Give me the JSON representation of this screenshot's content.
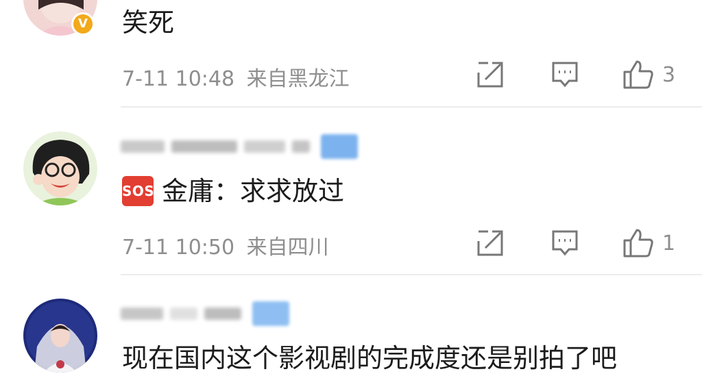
{
  "comments": [
    {
      "text": "笑死",
      "timestamp": "7-11 10:48",
      "location": "来自黑龙江",
      "likes": "3",
      "verified_badge": "V"
    },
    {
      "sos_label": "SOS",
      "text": "金庸：求求放过",
      "timestamp": "7-11 10:50",
      "location": "来自四川",
      "likes": "1"
    },
    {
      "text": "现在国内这个影视剧的完成度还是别拍了吧"
    }
  ],
  "icons": {
    "share": "share-icon",
    "comment": "comment-icon",
    "like": "like-icon"
  },
  "colors": {
    "verified": "#f2a91a",
    "sos": "#e23e32",
    "meta_text": "#8e8e8e",
    "body_text": "#1c1c1c"
  }
}
